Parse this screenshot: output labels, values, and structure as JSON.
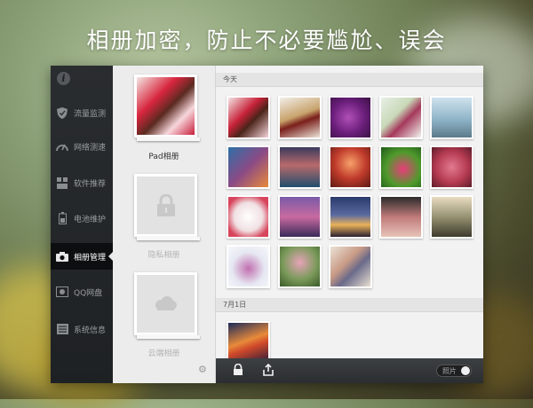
{
  "headline": "相册加密，防止不必要尴尬、误会",
  "sidebar": {
    "items": [
      {
        "label": "流量监测",
        "icon": "shield-icon"
      },
      {
        "label": "网络测速",
        "icon": "speedometer-icon"
      },
      {
        "label": "软件推荐",
        "icon": "app-grid-icon"
      },
      {
        "label": "电池维护",
        "icon": "battery-icon"
      },
      {
        "label": "相册管理",
        "icon": "camera-icon"
      },
      {
        "label": "QQ网盘",
        "icon": "cloud-drive-icon"
      },
      {
        "label": "系统信息",
        "icon": "list-icon"
      }
    ],
    "active_index": 4
  },
  "albums": {
    "items": [
      {
        "label": "Pad相册",
        "locked": false
      },
      {
        "label": "隐私相册",
        "locked": true
      },
      {
        "label": "云端相册",
        "locked": false
      }
    ]
  },
  "sections": [
    {
      "title": "今天"
    },
    {
      "title": "7月1日"
    }
  ],
  "toolbar": {
    "toggle_label": "照片"
  }
}
